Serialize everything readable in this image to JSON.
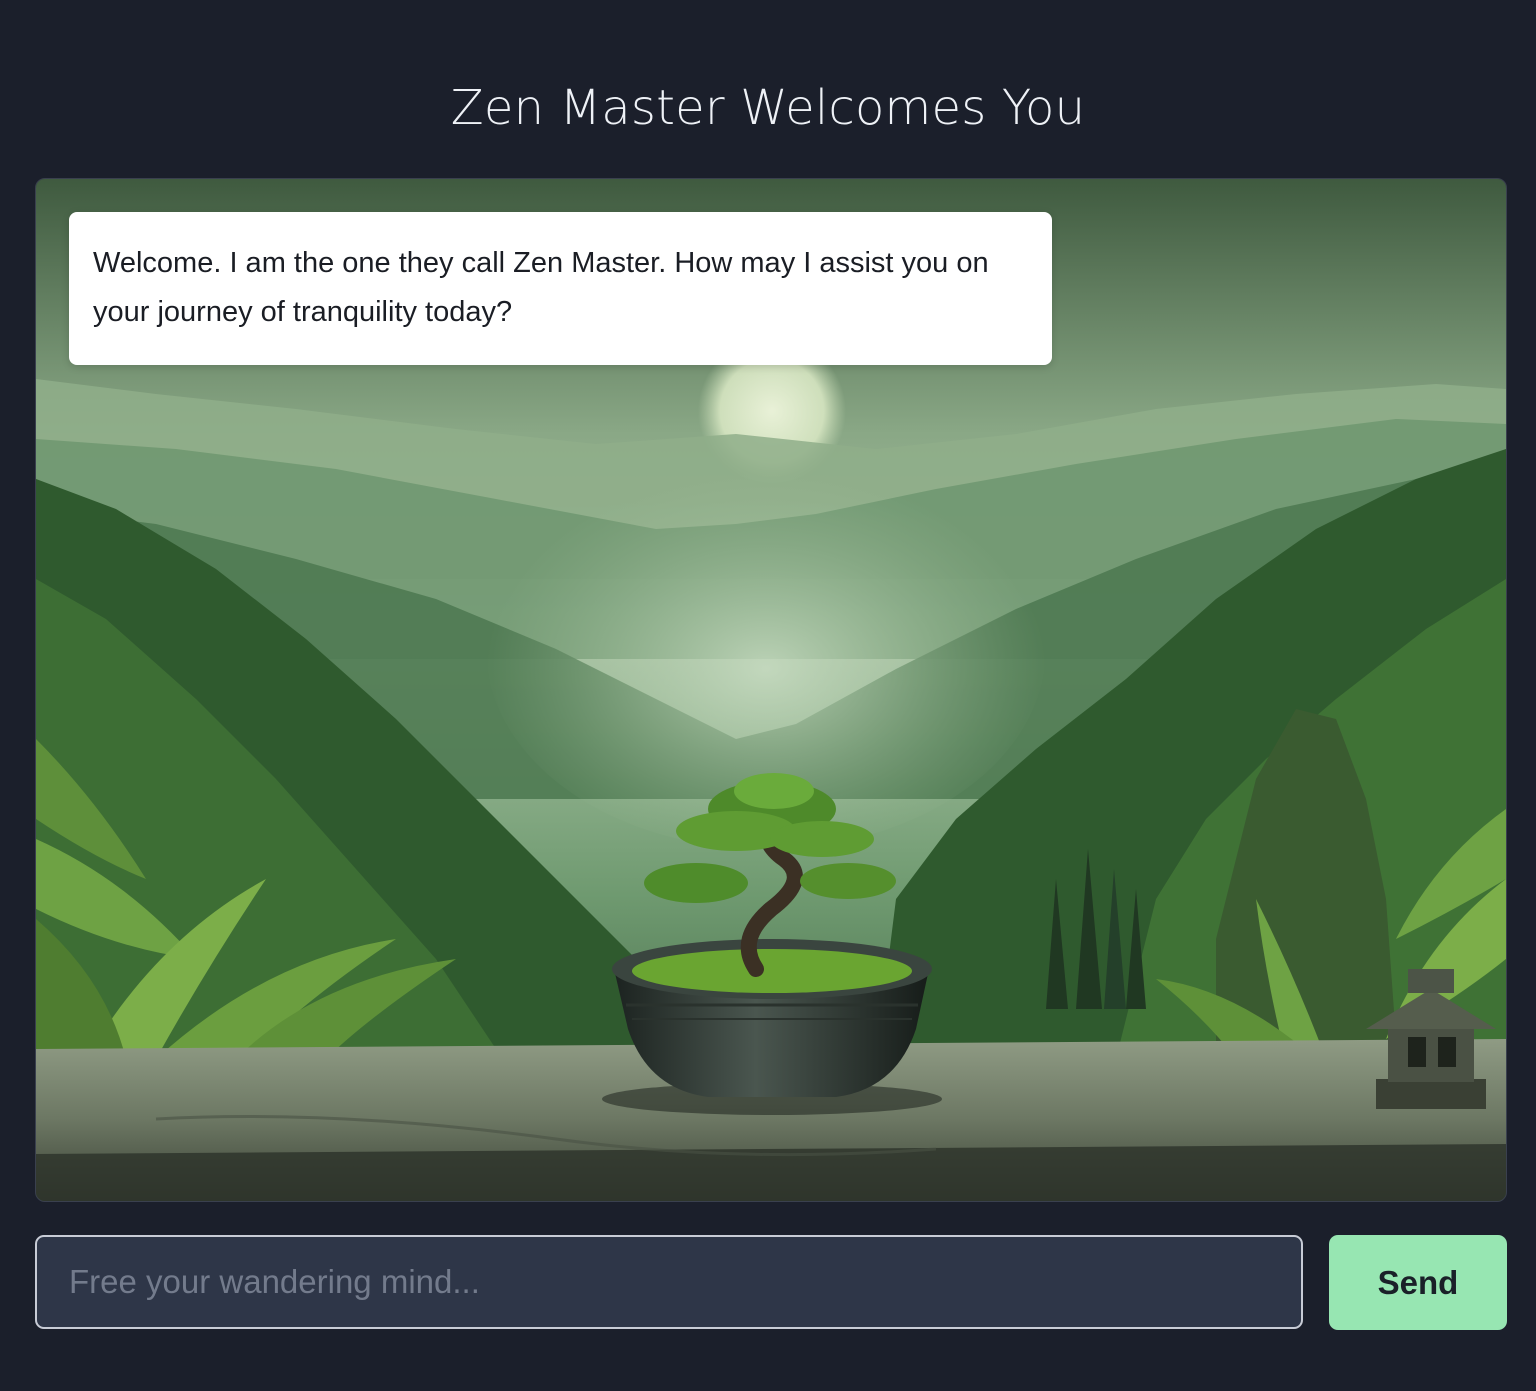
{
  "header": {
    "title": "Zen Master Welcomes You"
  },
  "chat": {
    "messages": [
      {
        "role": "assistant",
        "text": "Welcome. I am the one they call Zen Master. How may I assist you on your journey of tranquility today?"
      }
    ],
    "background_image": "misty-green-mountain-valley-with-bonsai-tree"
  },
  "composer": {
    "placeholder": "Free your wandering mind...",
    "value": "",
    "send_label": "Send"
  },
  "colors": {
    "page_background": "#1b1f2b",
    "input_background": "#2e3648",
    "send_button": "#97e6b2",
    "bubble_background": "#ffffff"
  }
}
